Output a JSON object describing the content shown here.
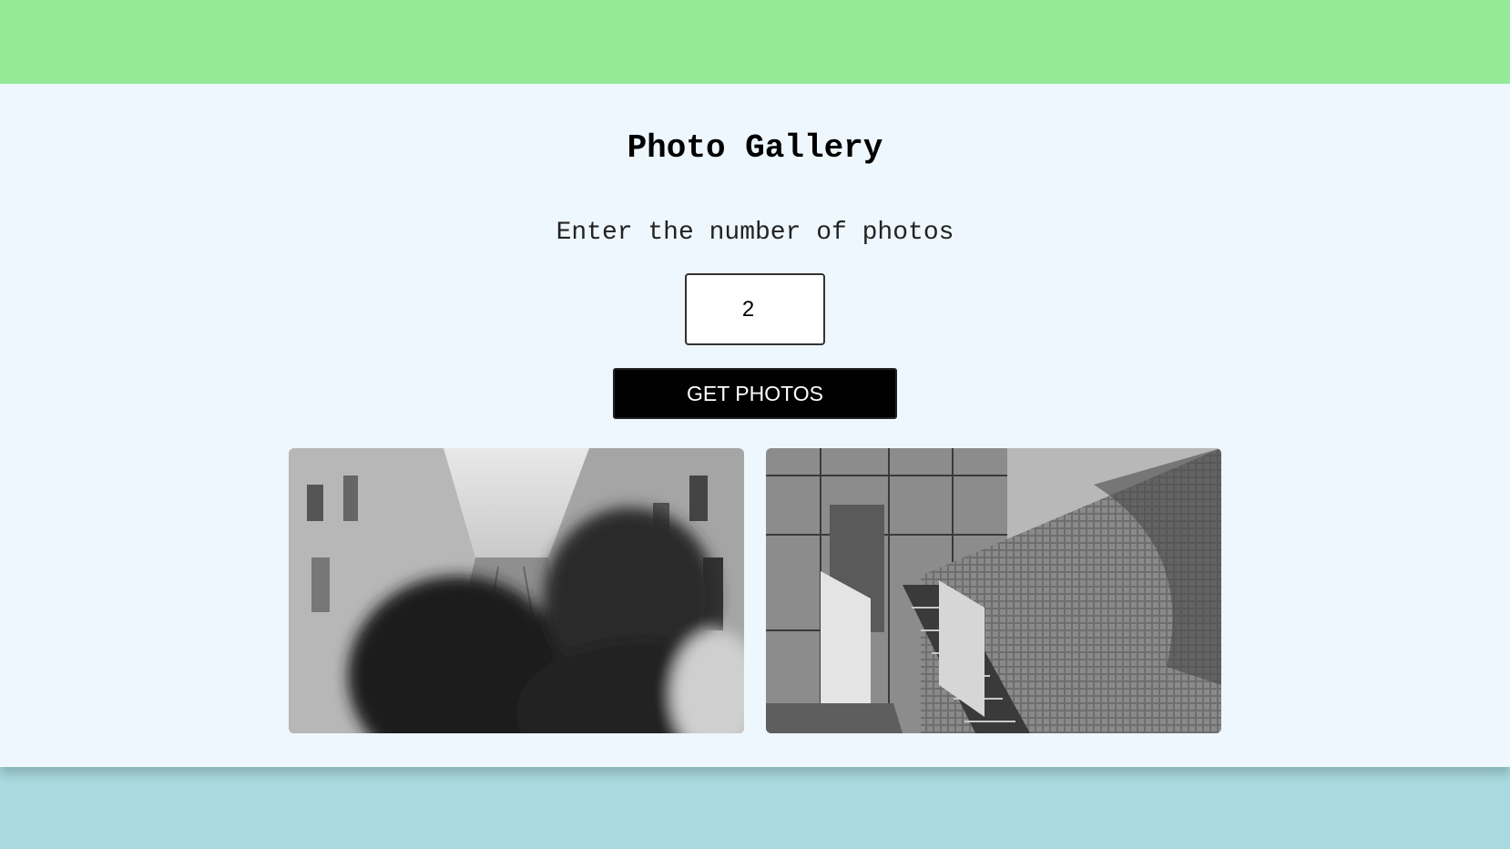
{
  "header": {
    "title": "Photo Gallery"
  },
  "form": {
    "prompt": "Enter the number of photos",
    "count_value": "2",
    "submit_label": "GET PHOTOS"
  },
  "gallery": {
    "photos": [
      {
        "description_icon": "street-couple-photo"
      },
      {
        "description_icon": "staircase-architecture-photo"
      }
    ]
  },
  "colors": {
    "top_band": "#95ea98",
    "panel": "#eef7fd",
    "bottom_band": "#a8dadf",
    "button": "#000000"
  }
}
